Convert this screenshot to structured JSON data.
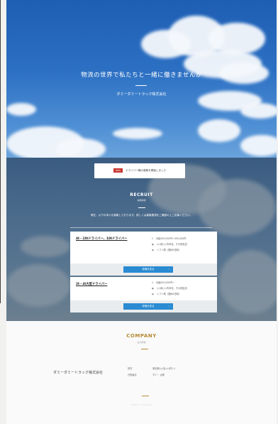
{
  "hero": {
    "title": "物流の世界で私たちと一緒に働きませんか",
    "company": "ダミーダミートラック株式会社"
  },
  "notice": {
    "badge": "NEW",
    "text": "ドライバー職の募集を開始しました"
  },
  "recruit": {
    "title": "RECRUIT",
    "subtitle": "採用情報",
    "description": "現在、以下の求人を募集しております。詳しくは募集要項をご確認の上ご応募ください。"
  },
  "jobs": [
    {
      "title": "4t・10tドライバー、10tドライバー",
      "salary": "月給300,000円〜450,000円",
      "location": "○○県○○市本社、その他支店",
      "holiday": "シフト制（週休2日制）",
      "button": "詳細を見る",
      "icons": [
        "yen-icon",
        "pin-icon",
        "calendar-icon"
      ]
    },
    {
      "title": "2t・4t大型ドライバー",
      "salary": "月給250,000円〜",
      "location": "○○県○○市本社、その他支店",
      "holiday": "シフト制（週休2日制）",
      "button": "詳細を見る",
      "icons": [
        "yen-icon",
        "pin-icon",
        "calendar-icon"
      ]
    }
  ],
  "company": {
    "title": "COMPANY",
    "subtitle": "会社概要",
    "name": "ダミーダミートラック株式会社",
    "info": [
      {
        "label": "所在",
        "value": "東京都○○区○○町1-1"
      },
      {
        "label": "代表者名",
        "value": "ダミー 太郎"
      }
    ]
  },
  "footer": {
    "copyright": "© ダミートラック Inc."
  },
  "colors": {
    "sky": "#2c70c3",
    "accent_gold": "#b58a34",
    "button_blue": "#2a8bd2",
    "badge_red": "#c8352e"
  }
}
